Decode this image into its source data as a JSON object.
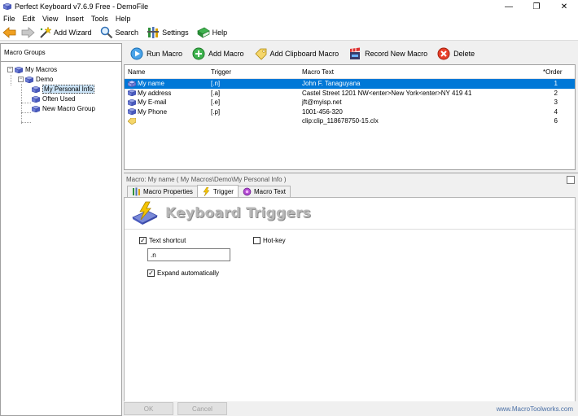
{
  "window": {
    "title": "Perfect Keyboard v7.6.9 Free - DemoFile",
    "controls": [
      "—",
      "❐",
      "✕"
    ]
  },
  "menu": [
    "File",
    "Edit",
    "View",
    "Insert",
    "Tools",
    "Help"
  ],
  "toolbar": {
    "add_wizard": "Add Wizard",
    "search": "Search",
    "settings": "Settings",
    "help": "Help"
  },
  "left_panel": {
    "header": "Macro Groups",
    "tree": {
      "root": "My Macros",
      "demo": "Demo",
      "children": [
        "My Personal Info",
        "Often Used",
        "New Macro Group"
      ]
    }
  },
  "actions": {
    "run": "Run Macro",
    "add": "Add Macro",
    "add_clipboard": "Add Clipboard Macro",
    "record": "Record New Macro",
    "delete": "Delete"
  },
  "macro_list": {
    "columns": [
      "Name",
      "Trigger",
      "Macro Text",
      "*Order"
    ],
    "rows": [
      {
        "name": "My name",
        "trigger": "[.n]",
        "text": "John F. Tanaguyana",
        "order": "1"
      },
      {
        "name": "My address",
        "trigger": "[.a]",
        "text": "Castel Street 1201 NW<enter>New York<enter>NY 419 41",
        "order": "2"
      },
      {
        "name": "My E-mail",
        "trigger": "[.e]",
        "text": "jft@myisp.net",
        "order": "3"
      },
      {
        "name": "My Phone",
        "trigger": "[.p]",
        "text": "1001-456-320",
        "order": "4"
      },
      {
        "name": "",
        "trigger": "",
        "text": "clip:clip_118678750-15.clx",
        "order": "6"
      }
    ]
  },
  "details": {
    "header": "Macro: My name ( My Macros\\Demo\\My Personal Info )",
    "tabs": [
      "Macro Properties",
      "Trigger",
      "Macro Text"
    ],
    "section_title": "Keyboard Triggers",
    "text_shortcut_label": "Text shortcut",
    "text_shortcut_value": ".n",
    "hotkey_label": "Hot-key",
    "expand_label": "Expand automatically"
  },
  "bottom": {
    "ok": "OK",
    "cancel": "Cancel",
    "footer": "www.MacroToolworks.com"
  },
  "colors": {
    "selection": "#0078d7",
    "tree_selection": "#cce4f7"
  }
}
